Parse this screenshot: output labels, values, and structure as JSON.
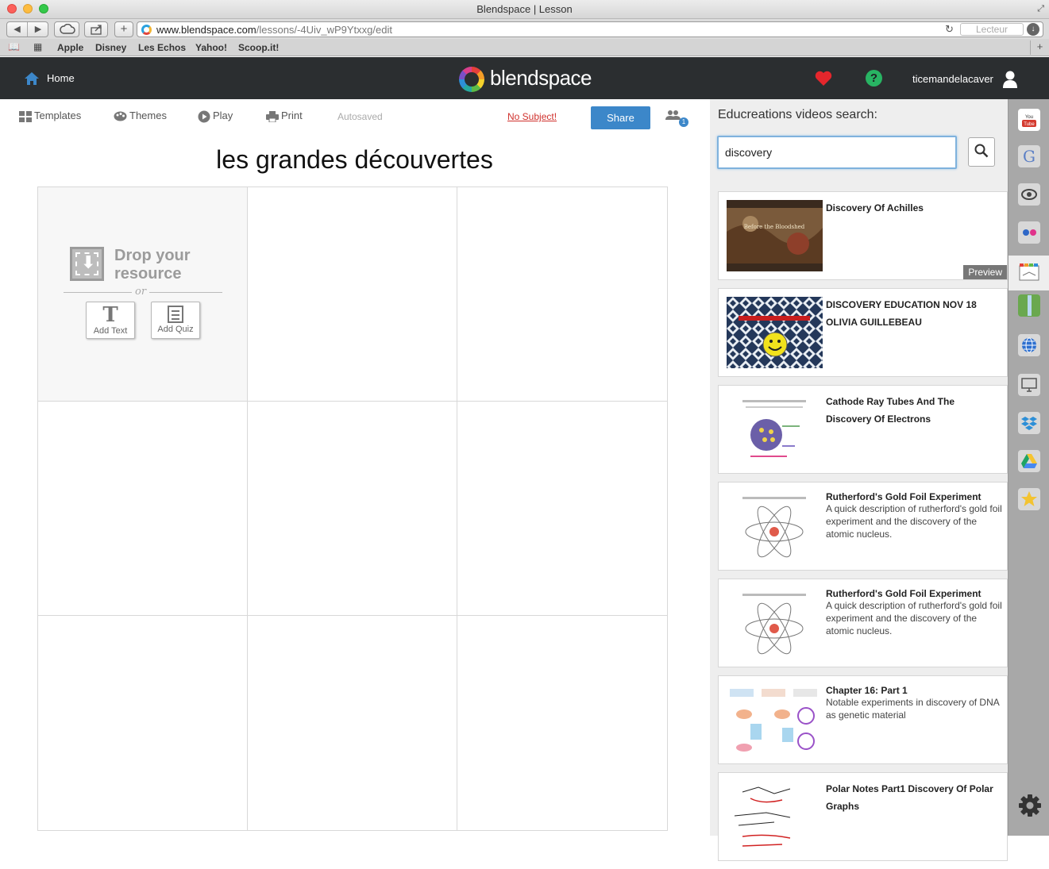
{
  "browser": {
    "window_title": "Blendspace | Lesson",
    "url_host": "www.blendspace.com",
    "url_path": "/lessons/-4Uiv_wP9Ytxxg/edit",
    "reader_label": "Lecteur",
    "bookmarks": [
      "Apple",
      "Disney",
      "Les Echos",
      "Yahoo!",
      "Scoop.it!"
    ]
  },
  "navbar": {
    "home_label": "Home",
    "logo_text": "blendspace",
    "username": "ticemandelacaver"
  },
  "toolbar": {
    "templates_label": "Templates",
    "themes_label": "Themes",
    "play_label": "Play",
    "print_label": "Print",
    "autosaved_label": "Autosaved",
    "no_subject_label": "No Subject!",
    "share_label": "Share",
    "collaborator_count": "1"
  },
  "lesson": {
    "title": "les grandes découvertes",
    "drop_line1": "Drop your",
    "drop_line2": "resource",
    "or_label": "or",
    "add_text_label": "Add Text",
    "add_quiz_label": "Add Quiz"
  },
  "panel": {
    "title": "Educreations videos search:",
    "search_value": "discovery",
    "preview_label": "Preview",
    "thumb1_caption": "Before the Bloodshed",
    "results": [
      {
        "title": "Discovery Of Achilles",
        "desc": ""
      },
      {
        "title": "DISCOVERY EDUCATION NOV 18 OLIVIA GUILLEBEAU",
        "desc": ""
      },
      {
        "title": "Cathode Ray Tubes And The Discovery Of Electrons",
        "desc": ""
      },
      {
        "title": "Rutherford's Gold Foil Experiment",
        "desc": "A quick description of rutherford's gold foil experiment and the discovery of the atomic nucleus."
      },
      {
        "title": "Rutherford's Gold Foil Experiment",
        "desc": "A quick description of rutherford's gold foil experiment and the discovery of the atomic nucleus."
      },
      {
        "title": "Chapter 16: Part 1",
        "desc": "Notable experiments in discovery of DNA as genetic material"
      },
      {
        "title": "Polar Notes Part1 Discovery Of Polar Graphs",
        "desc": ""
      }
    ]
  },
  "colors": {
    "navbar_bg": "#2b2e30",
    "share_blue": "#3c87c9",
    "no_subject_red": "#d0312d",
    "heart_red": "#e5262c",
    "help_green": "#28b463"
  },
  "sidebar_icons": [
    "youtube-icon",
    "google-icon",
    "eye-icon",
    "flickr-icon",
    "educreations-icon",
    "notebook-icon",
    "globe-icon",
    "monitor-icon",
    "dropbox-icon",
    "google-drive-icon",
    "star-icon",
    "gear-icon"
  ]
}
